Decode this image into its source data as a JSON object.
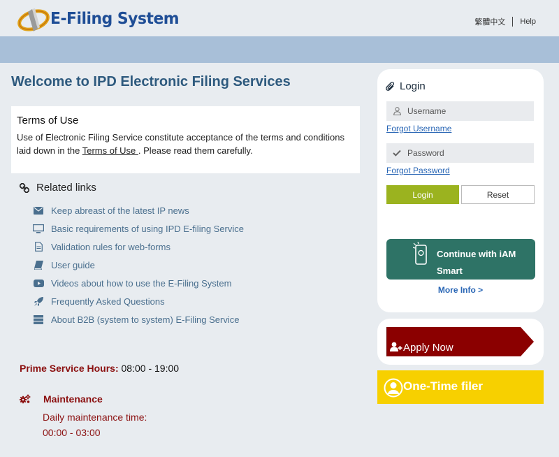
{
  "header": {
    "logo_text": "E-Filing System",
    "lang_link": "繁體中文",
    "help_link": "Help"
  },
  "main": {
    "title": "Welcome to IPD Electronic Filing Services",
    "terms": {
      "heading": "Terms of Use",
      "text_before": "Use of Electronic Filing Service constitute acceptance of the terms and conditions laid down in the ",
      "link": "Terms of Use ",
      "text_after": ". Please read them carefully."
    },
    "related": {
      "heading": "Related links",
      "items": [
        {
          "label": "Keep abreast of the latest IP news",
          "icon": "envelope-icon"
        },
        {
          "label": "Basic requirements of using IPD E-filing Service",
          "icon": "monitor-icon"
        },
        {
          "label": "Validation rules for web-forms",
          "icon": "document-icon"
        },
        {
          "label": "User guide",
          "icon": "book-icon"
        },
        {
          "label": "Videos about how to use the E-Filing System",
          "icon": "youtube-icon"
        },
        {
          "label": "Frequently Asked Questions",
          "icon": "rocket-icon"
        },
        {
          "label": "About B2B (system to system) E-Filing Service",
          "icon": "server-icon"
        }
      ]
    },
    "prime": {
      "label": "Prime Service Hours:",
      "value": " 08:00 - 19:00"
    },
    "maintenance": {
      "heading": "Maintenance",
      "line1": "Daily maintenance time:",
      "line2": "00:00 - 03:00"
    }
  },
  "login": {
    "title": "Login",
    "username_placeholder": "Username",
    "forgot_username": "Forgot Username",
    "password_placeholder": "Password",
    "forgot_password": "Forgot Password",
    "login_button": "Login",
    "reset_button": "Reset",
    "iam_button": "Continue with iAM Smart",
    "more_info": "More Info >"
  },
  "apply": {
    "label": "Apply Now"
  },
  "onetime": {
    "label": "One-Time filer"
  },
  "colors": {
    "accent_green": "#9bb31f",
    "iam_green": "#2e7366",
    "apply_red": "#8b0000",
    "onetime_yellow": "#f7d000",
    "title_blue": "#2e5a7e",
    "band_blue": "#a8bfd8"
  }
}
